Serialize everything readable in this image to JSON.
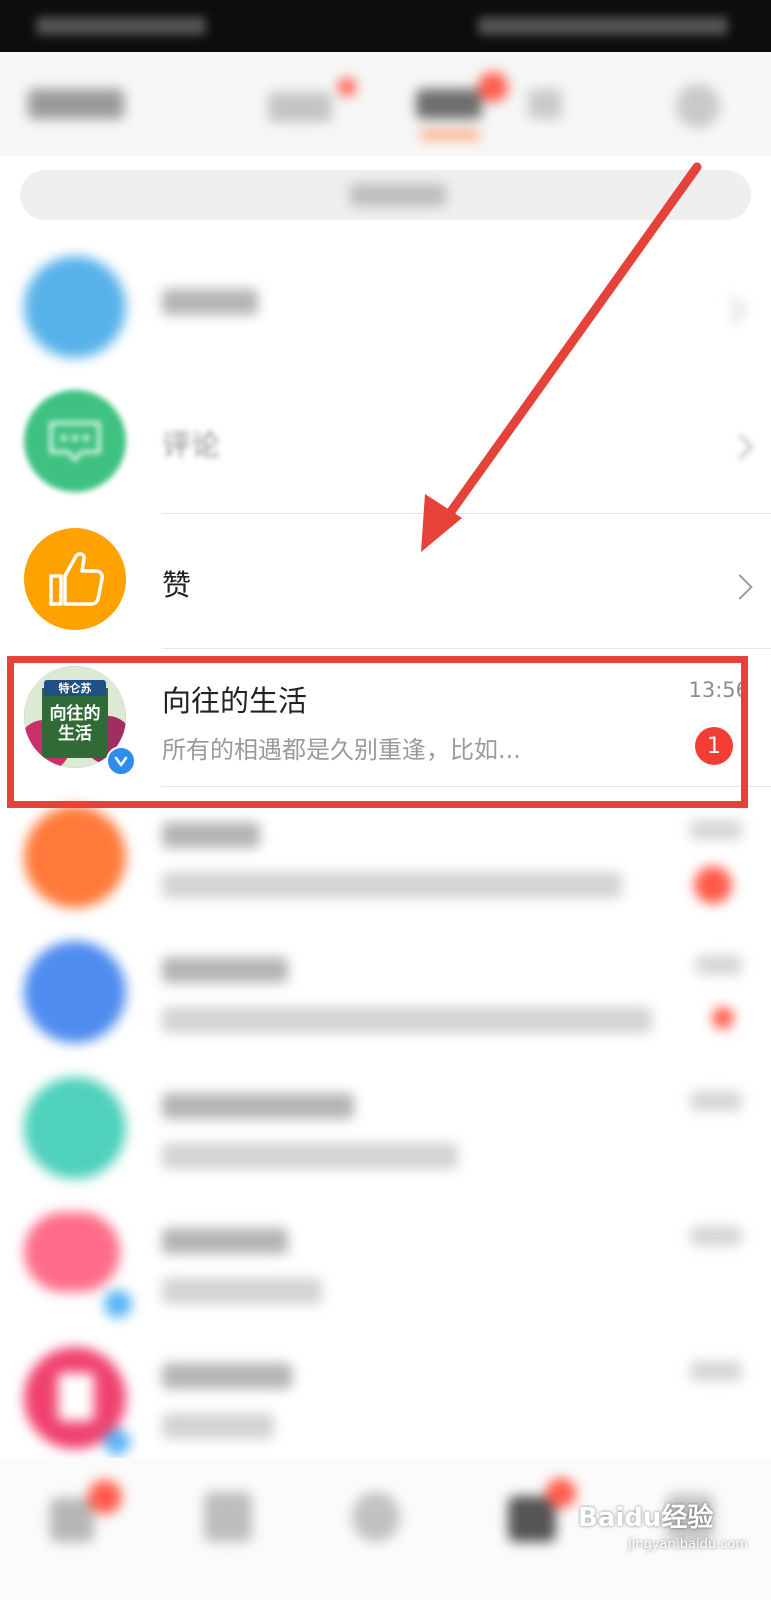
{
  "rows": {
    "comment": {
      "title": "评论"
    },
    "like": {
      "title": "赞"
    },
    "chat": {
      "title": "向往的生活",
      "preview": "所有的相遇都是久别重逢，比如...",
      "time": "13:56",
      "unread": "1",
      "avatar_banner": "特仑苏",
      "avatar_text": "向往的生活"
    }
  },
  "watermark": {
    "brand": "Baidu经验",
    "url": "jingyan.baidu.com"
  },
  "colors": {
    "accent_red": "#e5423a",
    "badge_red": "#f23c34",
    "like_orange": "#ffa200",
    "comment_green": "#3fc281",
    "verified_blue": "#2d8cf0"
  },
  "icons": [
    "comment-bubble-icon",
    "thumbs-up-icon",
    "chevron-right-icon",
    "verified-icon",
    "arrow-annotation"
  ]
}
